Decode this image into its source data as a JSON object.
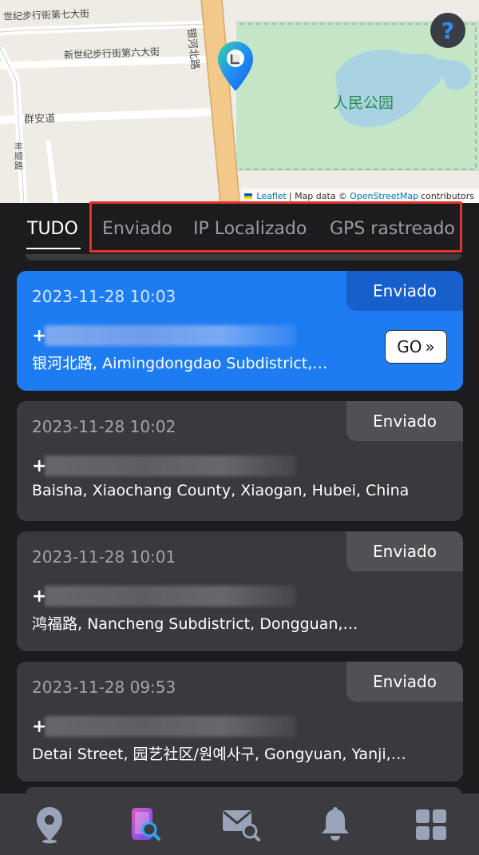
{
  "map": {
    "road_labels": {
      "r7": "世纪步行街第七大街",
      "r6": "新世纪步行街第六大街",
      "anning": "群安道",
      "fengshun": "丰顺路",
      "yinhe": "银河北路"
    },
    "park_label": "人民公园",
    "help_label": "?",
    "attribution": {
      "leaflet": "Leaflet",
      "sep": "| Map data ©",
      "osm": "OpenStreetMap",
      "contributors": "contributors"
    }
  },
  "tabs": [
    {
      "label": "TUDO",
      "active": true
    },
    {
      "label": "Enviado",
      "active": false
    },
    {
      "label": "IP Localizado",
      "active": false
    },
    {
      "label": "GPS rastreado",
      "active": false
    }
  ],
  "records": [
    {
      "date": "2023-11-28 10:03",
      "status": "Enviado",
      "address": "银河北路, Aimingdongdao Subdistrict,…",
      "selected": true
    },
    {
      "date": "2023-11-28 10:02",
      "status": "Enviado",
      "address": "Baisha, Xiaochang County, Xiaogan, Hubei, China",
      "selected": false
    },
    {
      "date": "2023-11-28 10:01",
      "status": "Enviado",
      "address": "鸿福路, Nancheng Subdistrict, Dongguan,…",
      "selected": false
    },
    {
      "date": "2023-11-28 09:53",
      "status": "Enviado",
      "address": "Detai Street, 园艺社区/원예사구, Gongyuan, Yanji,…",
      "selected": false
    }
  ],
  "contact_prefix": "+",
  "go_button": {
    "label": "GO",
    "chevron": "»"
  },
  "bottom_nav": [
    {
      "icon": "location-pin-icon"
    },
    {
      "icon": "phone-search-icon"
    },
    {
      "icon": "mail-search-icon"
    },
    {
      "icon": "bell-icon"
    },
    {
      "icon": "apps-grid-icon"
    }
  ],
  "colors": {
    "accent_blue": "#1e7cf2",
    "card_bg": "#3a3a3e",
    "highlight_red": "#e3312d",
    "map_park": "#bfe3c5",
    "map_water": "#a9d3e3",
    "map_road_main": "#f2c98a"
  }
}
